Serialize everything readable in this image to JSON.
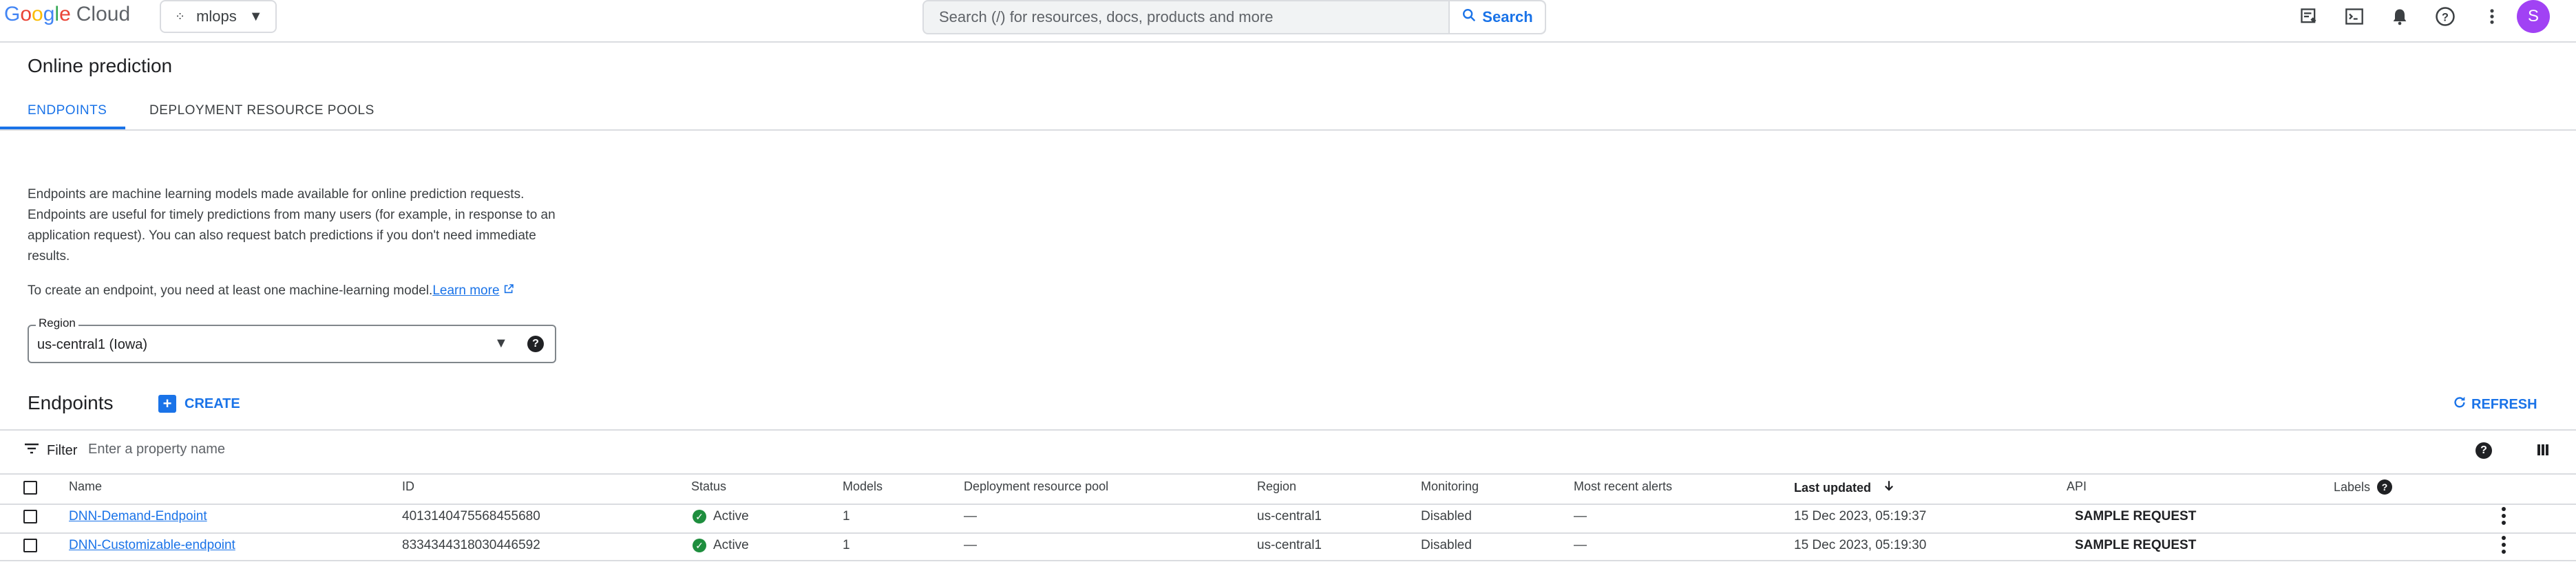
{
  "topbar": {
    "logo_text": "Google",
    "logo_cloud": "Cloud",
    "project": "mlops",
    "search_placeholder": "Search (/) for resources, docs, products and more",
    "search_button": "Search",
    "avatar_initial": "S"
  },
  "page": {
    "title": "Online prediction",
    "tabs": [
      "ENDPOINTS",
      "DEPLOYMENT RESOURCE POOLS"
    ],
    "description": "Endpoints are machine learning models made available for online prediction requests. Endpoints are useful for timely predictions from many users (for example, in response to an application request). You can also request batch predictions if you don't need immediate results.",
    "create_note": "To create an endpoint, you need at least one machine-learning model.",
    "learn_more": "Learn more",
    "region_label": "Region",
    "region_value": "us-central1 (Iowa)"
  },
  "endpoints": {
    "heading": "Endpoints",
    "create_label": "CREATE",
    "refresh_label": "REFRESH",
    "filter_label": "Filter",
    "filter_placeholder": "Enter a property name",
    "columns": [
      "Name",
      "ID",
      "Status",
      "Models",
      "Deployment resource pool",
      "Region",
      "Monitoring",
      "Most recent alerts",
      "Last updated",
      "API",
      "Labels"
    ],
    "rows": [
      {
        "name": "DNN-Demand-Endpoint",
        "id": "4013140475568455680",
        "status": "Active",
        "models": "1",
        "pool": "—",
        "region": "us-central1",
        "monitoring": "Disabled",
        "alerts": "—",
        "updated": "15 Dec 2023, 05:19:37",
        "api": "SAMPLE REQUEST"
      },
      {
        "name": "DNN-Customizable-endpoint",
        "id": "8334344318030446592",
        "status": "Active",
        "models": "1",
        "pool": "—",
        "region": "us-central1",
        "monitoring": "Disabled",
        "alerts": "—",
        "updated": "15 Dec 2023, 05:19:30",
        "api": "SAMPLE REQUEST"
      }
    ]
  },
  "colors": {
    "accent": "#1a73e8",
    "success": "#1e8e3e",
    "avatar": "#a142f4"
  },
  "icons": [
    "notes-icon",
    "terminal-icon",
    "bell-icon",
    "help-icon",
    "more-vert-icon"
  ]
}
